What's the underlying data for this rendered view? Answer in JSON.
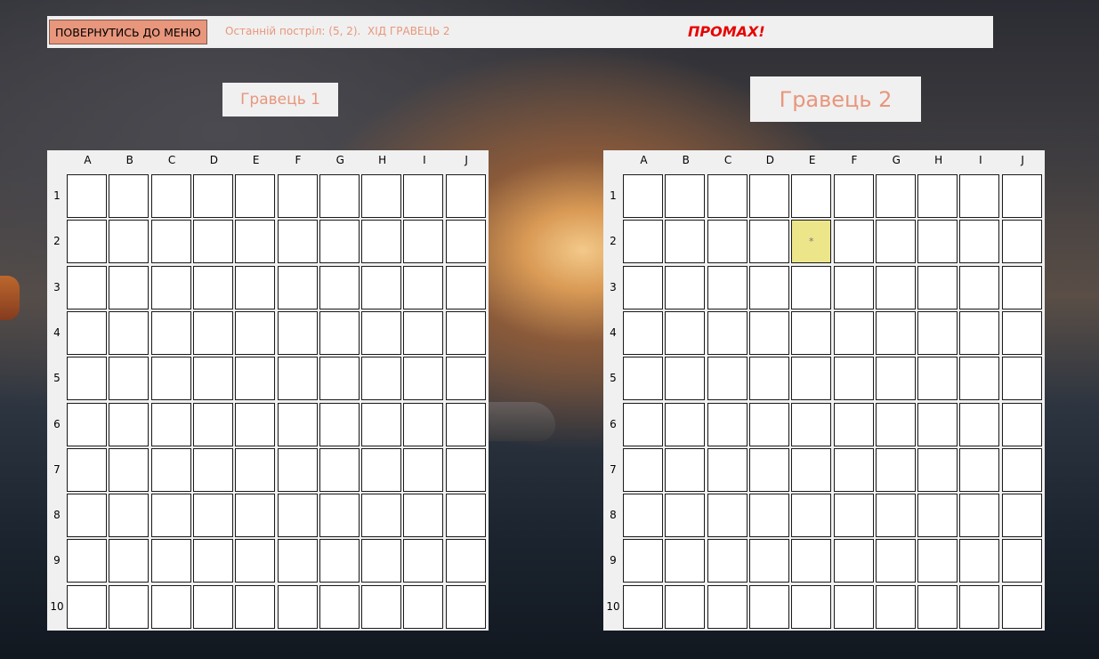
{
  "header": {
    "menu_button": "ПОВЕРНУТИСЬ ДО МЕНЮ",
    "last_shot": "Останній постріл: (5, 2).  ХІД ГРАВЕЦЬ 2",
    "result": "ПРОМАХ!"
  },
  "players": [
    {
      "label": "Гравець 1"
    },
    {
      "label": "Гравець 2"
    }
  ],
  "columns": [
    "A",
    "B",
    "C",
    "D",
    "E",
    "F",
    "G",
    "H",
    "I",
    "J"
  ],
  "rows": [
    "1",
    "2",
    "3",
    "4",
    "5",
    "6",
    "7",
    "8",
    "9",
    "10"
  ],
  "boards": [
    {
      "marks": []
    },
    {
      "marks": [
        {
          "col": "E",
          "row": "2",
          "symbol": "*",
          "state": "miss"
        }
      ]
    }
  ],
  "colors": {
    "accent": "#e8967c",
    "result": "#e80000",
    "miss_cell": "#ede58a"
  }
}
